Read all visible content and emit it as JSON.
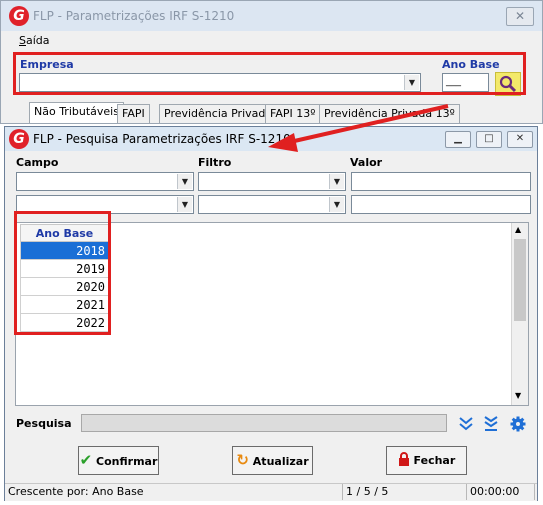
{
  "main_window": {
    "title": "FLP - Parametrizações IRF S-1210",
    "close_glyph": "✕",
    "menu": {
      "saida_first": "S",
      "saida_rest": "aída"
    },
    "empresa_label": "Empresa",
    "empresa_value": "",
    "ano_base_label": "Ano Base",
    "ano_base_value": "___",
    "tabs": [
      "Não Tributáveis",
      "FAPI",
      "Previdência Privada",
      "FAPI 13º",
      "Previdência Privada 13º"
    ]
  },
  "dialog": {
    "title": "FLP - Pesquisa Parametrizações IRF S-1210",
    "columns": {
      "campo": "Campo",
      "filtro": "Filtro",
      "valor": "Valor"
    },
    "grid": {
      "header": "Ano Base",
      "rows": [
        "2018",
        "2019",
        "2020",
        "2021",
        "2022"
      ],
      "selected_index": 0
    },
    "pesquisa_label": "Pesquisa",
    "pesquisa_value": "",
    "buttons": {
      "confirmar": "Confirmar",
      "atualizar": "Atualizar",
      "fechar": "Fechar"
    },
    "status": {
      "sort": "Crescente por: Ano Base",
      "count": "1 / 5 / 5",
      "time": "00:00:00"
    }
  },
  "colors": {
    "highlight": "#e02020",
    "accent_blue": "#1f3aa6",
    "selection": "#1a6fd6"
  },
  "icons": [
    "app-logo-icon",
    "close-icon",
    "search-icon",
    "minimize-icon",
    "maximize-icon",
    "double-chevron-down-icon",
    "chevrons-down-bar-icon",
    "gear-icon",
    "check-icon",
    "refresh-icon",
    "lock-icon"
  ]
}
